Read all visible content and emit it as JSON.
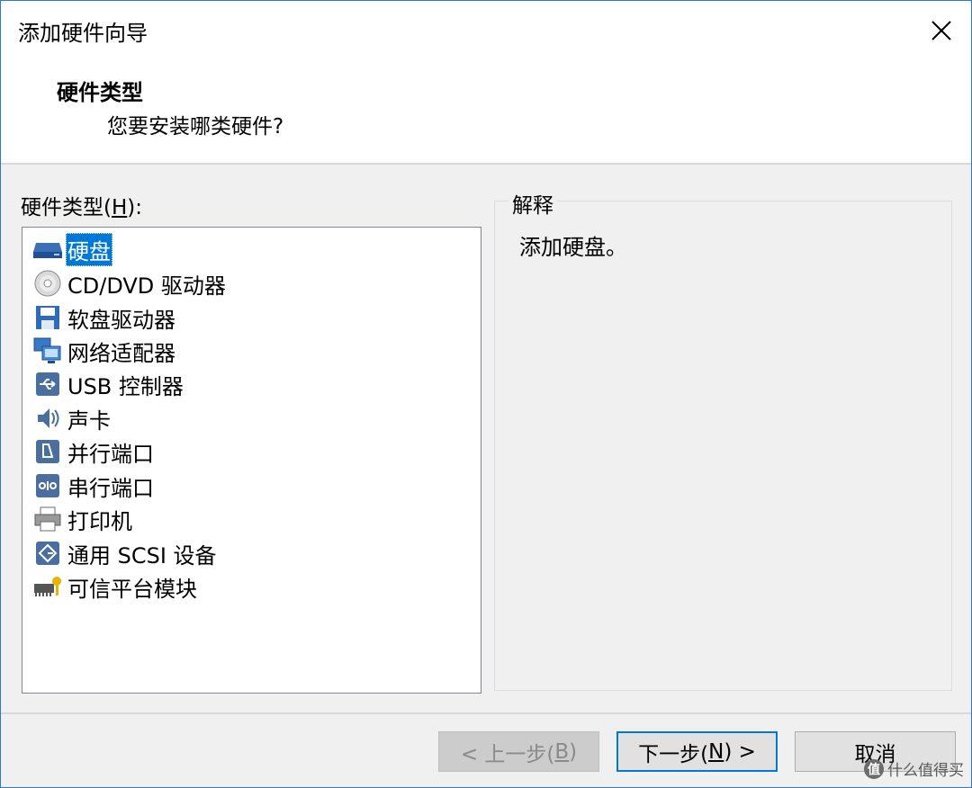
{
  "window": {
    "title": "添加硬件向导"
  },
  "header": {
    "title": "硬件类型",
    "subtitle": "您要安装哪类硬件?"
  },
  "hardware_list": {
    "label_prefix": "硬件类型(",
    "label_key": "H",
    "label_suffix": "):",
    "items": [
      {
        "label": "硬盘",
        "icon": "hard-disk-icon",
        "selected": true
      },
      {
        "label": "CD/DVD 驱动器",
        "icon": "cd-dvd-icon",
        "selected": false
      },
      {
        "label": "软盘驱动器",
        "icon": "floppy-icon",
        "selected": false
      },
      {
        "label": "网络适配器",
        "icon": "network-adapter-icon",
        "selected": false
      },
      {
        "label": "USB 控制器",
        "icon": "usb-icon",
        "selected": false
      },
      {
        "label": "声卡",
        "icon": "sound-card-icon",
        "selected": false
      },
      {
        "label": "并行端口",
        "icon": "parallel-port-icon",
        "selected": false
      },
      {
        "label": "串行端口",
        "icon": "serial-port-icon",
        "selected": false
      },
      {
        "label": "打印机",
        "icon": "printer-icon",
        "selected": false
      },
      {
        "label": "通用 SCSI 设备",
        "icon": "scsi-icon",
        "selected": false
      },
      {
        "label": "可信平台模块",
        "icon": "tpm-icon",
        "selected": false
      }
    ]
  },
  "explanation": {
    "group_title": "解释",
    "text": "添加硬盘。"
  },
  "buttons": {
    "back": {
      "prefix": "< 上一步(",
      "key": "B",
      "suffix": ")",
      "enabled": false
    },
    "next": {
      "prefix": "下一步(",
      "key": "N",
      "suffix": ") >",
      "enabled": true
    },
    "cancel": {
      "label": "取消",
      "enabled": true
    }
  },
  "watermark": {
    "badge": "值",
    "text": "什么值得买"
  },
  "colors": {
    "selection": "#0078d7",
    "window_border": "#2b79d0",
    "dialog_bg": "#f0f0f0"
  }
}
